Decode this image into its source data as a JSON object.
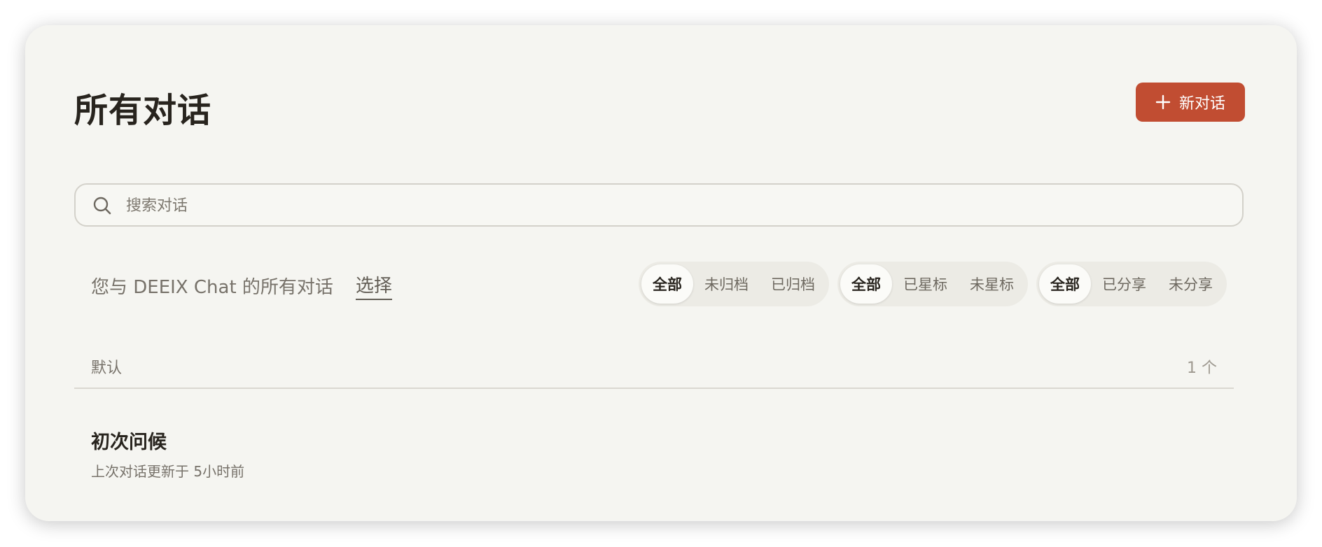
{
  "page": {
    "title": "所有对话"
  },
  "header": {
    "new_chat_label": "新对话"
  },
  "search": {
    "placeholder": "搜索对话",
    "value": ""
  },
  "subtitle": {
    "description": "您与 DEEIX Chat 的所有对话",
    "select_label": "选择"
  },
  "filters": {
    "archive": {
      "options": [
        "全部",
        "未归档",
        "已归档"
      ],
      "selected": "全部"
    },
    "star": {
      "options": [
        "全部",
        "已星标",
        "未星标"
      ],
      "selected": "全部"
    },
    "share": {
      "options": [
        "全部",
        "已分享",
        "未分享"
      ],
      "selected": "全部"
    }
  },
  "groups": [
    {
      "name": "默认",
      "count_label": "1 个",
      "conversations": [
        {
          "title": "初次问候",
          "meta": "上次对话更新于 5小时前"
        }
      ]
    }
  ],
  "colors": {
    "accent": "#c14d32",
    "card_background": "#f5f5f1",
    "text_primary": "#28241e",
    "text_secondary": "#77726a"
  },
  "icons": {
    "new_chat": "plus-icon",
    "search": "search-icon"
  }
}
